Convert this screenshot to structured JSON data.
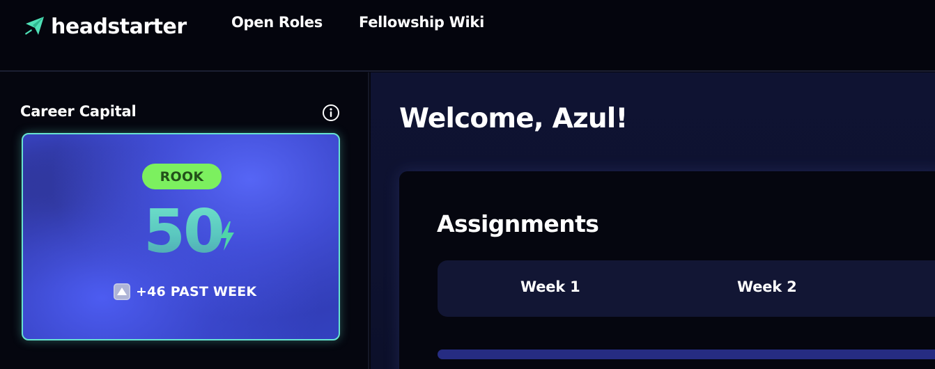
{
  "nav": {
    "brand": "headstarter",
    "links": [
      {
        "label": "Open Roles"
      },
      {
        "label": "Fellowship Wiki"
      }
    ],
    "brand_color": "#4fe0b6"
  },
  "sidebar": {
    "title": "Career Capital",
    "info_icon": "info-circle-icon",
    "card": {
      "rank": "ROOK",
      "score": "50",
      "score_icon": "lightning-bolt-icon",
      "weekly_change": "+46 PAST WEEK",
      "change_icon": "up-triangle-icon",
      "accent": "#67e3d0",
      "badge_color": "#7cf05f"
    }
  },
  "main": {
    "welcome": "Welcome, Azul!",
    "assignments": {
      "title": "Assignments",
      "tabs": [
        {
          "label": "Week 1"
        },
        {
          "label": "Week 2"
        }
      ],
      "progress": 1.0
    }
  }
}
